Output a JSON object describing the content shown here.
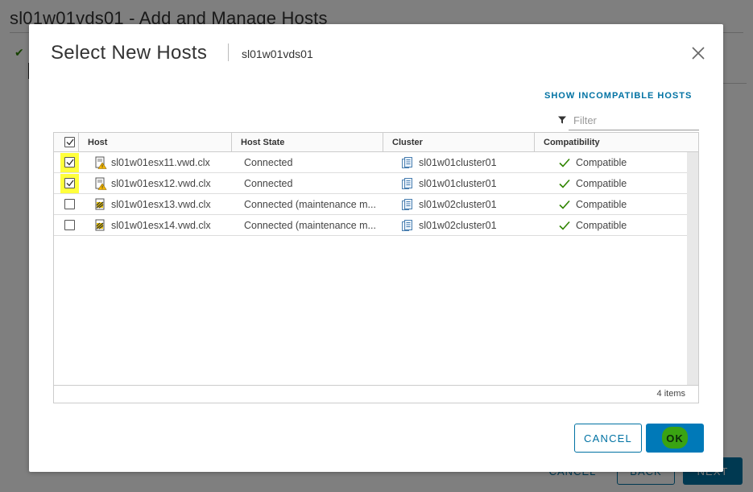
{
  "background": {
    "title": "sl01w01vds01 - Add and Manage Hosts",
    "footer": {
      "cancel": "CANCEL",
      "back": "BACK",
      "next": "NEXT"
    }
  },
  "modal": {
    "title": "Select New Hosts",
    "subtitle": "sl01w01vds01",
    "show_incompatible": "SHOW INCOMPATIBLE HOSTS",
    "filter_placeholder": "Filter",
    "columns": [
      "Host",
      "Host State",
      "Cluster",
      "Compatibility"
    ],
    "rows": [
      {
        "checked": true,
        "highlighted": true,
        "host": "sl01w01esx11.vwd.clx",
        "host_icon": "host-warning-icon",
        "state": "Connected",
        "cluster": "sl01w01cluster01",
        "compat": "Compatible"
      },
      {
        "checked": true,
        "highlighted": true,
        "host": "sl01w01esx12.vwd.clx",
        "host_icon": "host-warning-icon",
        "state": "Connected",
        "cluster": "sl01w01cluster01",
        "compat": "Compatible"
      },
      {
        "checked": false,
        "highlighted": false,
        "host": "sl01w01esx13.vwd.clx",
        "host_icon": "host-maintenance-icon",
        "state": "Connected (maintenance m...",
        "cluster": "sl01w02cluster01",
        "compat": "Compatible"
      },
      {
        "checked": false,
        "highlighted": false,
        "host": "sl01w01esx14.vwd.clx",
        "host_icon": "host-maintenance-icon",
        "state": "Connected (maintenance m...",
        "cluster": "sl01w02cluster01",
        "compat": "Compatible"
      }
    ],
    "item_count": "4 items",
    "cancel_label": "CANCEL",
    "ok_label": "OK"
  },
  "colors": {
    "accent": "#0072a3",
    "highlight": "#ffff3c",
    "ok_highlight": "#3aa312",
    "compatible": "#2f8400"
  }
}
